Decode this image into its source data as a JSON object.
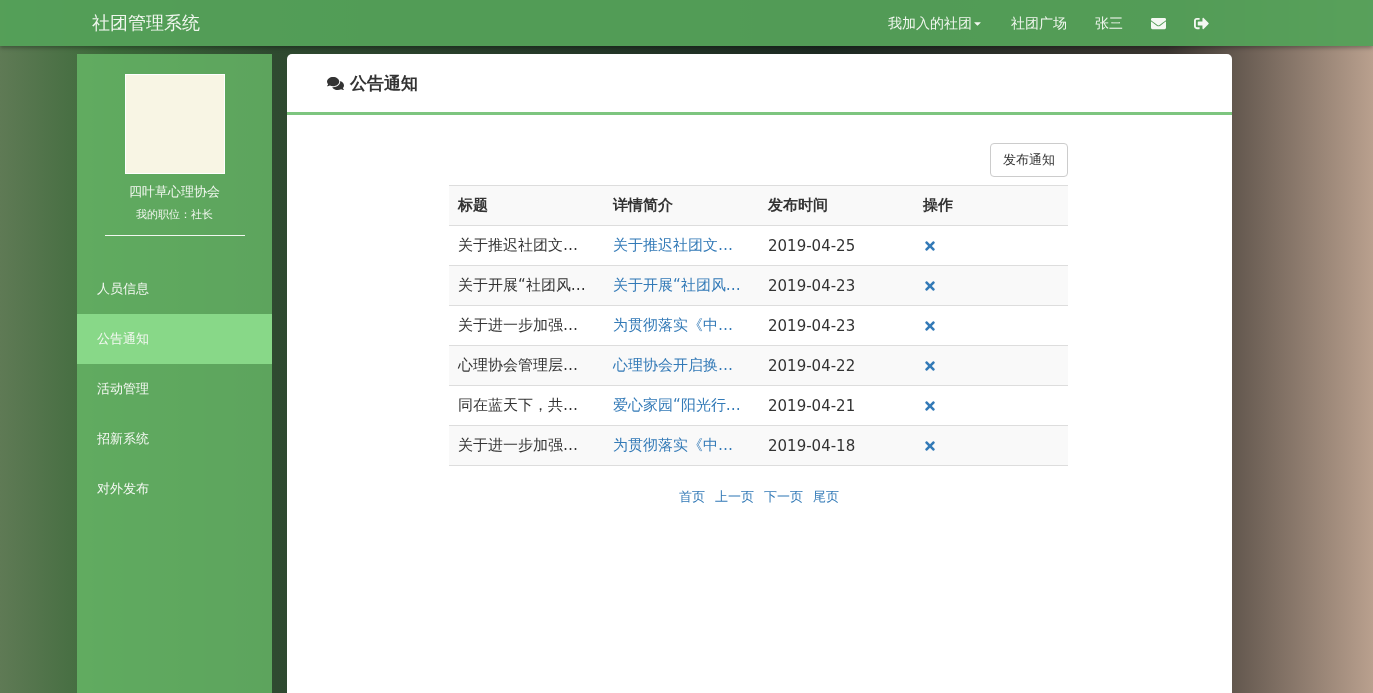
{
  "navbar": {
    "brand": "社团管理系统",
    "items": [
      {
        "label": "我加入的社团",
        "kind": "dropdown"
      },
      {
        "label": "社团广场",
        "kind": "link"
      },
      {
        "label": "张三",
        "kind": "link"
      }
    ]
  },
  "sidebar": {
    "club_name": "四叶草心理协会",
    "position": "我的职位：社长",
    "items": [
      {
        "label": "人员信息",
        "selected": false
      },
      {
        "label": "公告通知",
        "selected": true
      },
      {
        "label": "活动管理",
        "selected": false
      },
      {
        "label": "招新系统",
        "selected": false
      },
      {
        "label": "对外发布",
        "selected": false
      }
    ]
  },
  "panel": {
    "title": "公告通知",
    "publish_button": "发布通知"
  },
  "table": {
    "columns": [
      "标题",
      "详情简介",
      "发布时间",
      "操作"
    ],
    "rows": [
      {
        "title": "关于推迟社团文…",
        "summary": "关于推迟社团文…",
        "date": "2019-04-25"
      },
      {
        "title": "关于开展“社团风…",
        "summary": "关于开展“社团风…",
        "date": "2019-04-23"
      },
      {
        "title": "关于进一步加强…",
        "summary": "为贯彻落实《中…",
        "date": "2019-04-23"
      },
      {
        "title": "心理协会管理层…",
        "summary": "心理协会开启换…",
        "date": "2019-04-22"
      },
      {
        "title": "同在蓝天下，共…",
        "summary": "爱心家园“阳光行…",
        "date": "2019-04-21"
      },
      {
        "title": "关于进一步加强…",
        "summary": "为贯彻落实《中…",
        "date": "2019-04-18"
      }
    ]
  },
  "pagination": [
    "首页",
    "上一页",
    "下一页",
    "尾页"
  ]
}
